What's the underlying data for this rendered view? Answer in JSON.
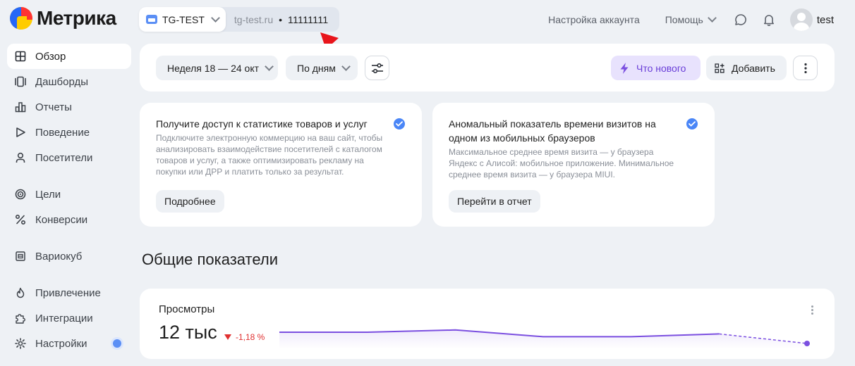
{
  "header": {
    "logo_text": "Метрика",
    "counter": {
      "name": "TG-TEST",
      "domain": "tg-test.ru",
      "separator": "•",
      "id": "11111111"
    },
    "account_settings": "Настройка аккаунта",
    "help": "Помощь",
    "user_name": "test"
  },
  "sidebar": {
    "items": [
      {
        "label": "Обзор",
        "icon": "grid-icon"
      },
      {
        "label": "Дашборды",
        "icon": "dashboard-icon"
      },
      {
        "label": "Отчеты",
        "icon": "bar-chart-icon"
      },
      {
        "label": "Поведение",
        "icon": "play-icon"
      },
      {
        "label": "Посетители",
        "icon": "person-icon"
      },
      {
        "label": "Цели",
        "icon": "target-icon"
      },
      {
        "label": "Конверсии",
        "icon": "percent-icon"
      },
      {
        "label": "Вариокуб",
        "icon": "cube-icon"
      },
      {
        "label": "Привлечение",
        "icon": "flame-icon"
      },
      {
        "label": "Интеграции",
        "icon": "puzzle-icon"
      },
      {
        "label": "Настройки",
        "icon": "gear-icon"
      }
    ]
  },
  "toolbar": {
    "period": "Неделя 18 — 24 окт",
    "grouping": "По дням",
    "whats_new": "Что нового",
    "add": "Добавить"
  },
  "cards": [
    {
      "title": "Получите доступ к статистике товаров и услуг",
      "text": "Подключите электронную коммерцию на ваш сайт, чтобы анализировать взаимодействие посетителей с каталогом товаров и услуг, а также оптимизировать рекламу на покупки или ДРР и платить только за результат.",
      "button": "Подробнее"
    },
    {
      "title": "Аномальный показатель времени визитов на одном из мобильных браузеров",
      "text": "Максимальное среднее время визита — у браузера Яндекс с Алисой: мобильное приложение. Минимальное среднее время визита — у браузера MIUI.",
      "button": "Перейти в отчет"
    }
  ],
  "section_title": "Общие показатели",
  "widget": {
    "title": "Просмотры",
    "value": "12 тыс",
    "delta": "-1,18 %"
  },
  "colors": {
    "accent": "#7b4fe0",
    "negative": "#e03131",
    "check": "#4a86f7",
    "annotation": "#e8151b"
  },
  "chart_data": {
    "type": "line",
    "series": [
      {
        "values": [
          100,
          100,
          104,
          92,
          92,
          97,
          80
        ]
      }
    ],
    "dashed_last_segment": true
  }
}
